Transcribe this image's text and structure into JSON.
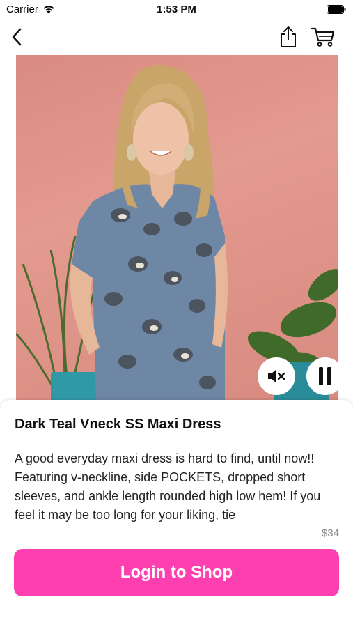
{
  "status_bar": {
    "carrier": "Carrier",
    "time": "1:53 PM"
  },
  "nav": {
    "icons": [
      "chevron-left-icon",
      "share-icon",
      "cart-icon"
    ]
  },
  "video": {
    "controls": [
      "mute-icon",
      "pause-icon"
    ]
  },
  "product": {
    "title": "Dark Teal Vneck SS Maxi Dress",
    "description": "A good everyday maxi dress is hard to find, until now!! Featuring v-neckline, side POCKETS, dropped short sleeves, and ankle length rounded high low hem! If you feel it may be too long for your liking, tie",
    "price": "$34"
  },
  "cta": {
    "login_label": "Login to Shop"
  },
  "colors": {
    "accent": "#fd3fb0",
    "background": "#ffffff",
    "video_backdrop": "#e39a8f"
  }
}
